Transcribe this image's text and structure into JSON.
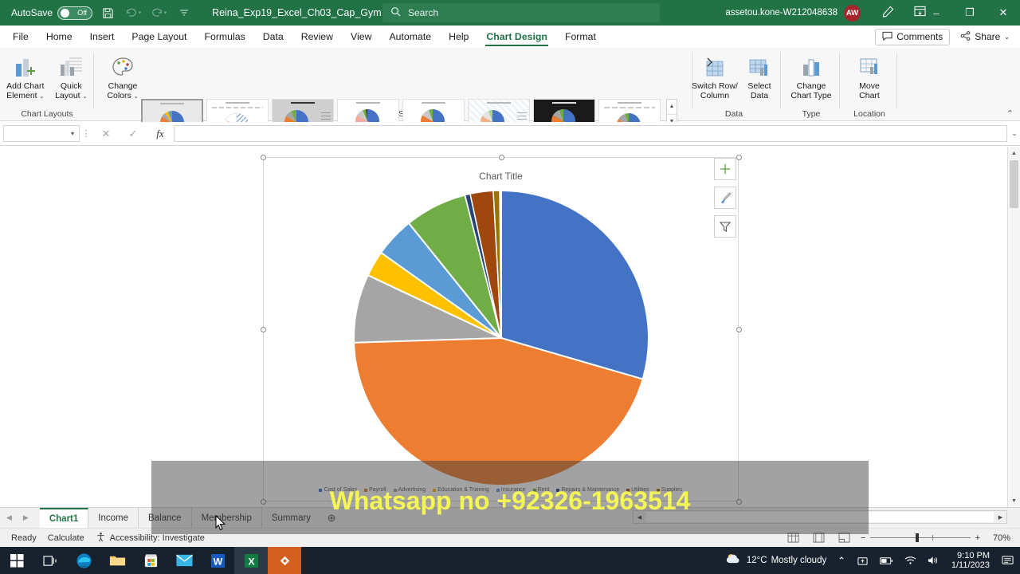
{
  "titlebar": {
    "autosave_label": "AutoSave",
    "autosave_state": "Off",
    "save_icon": "save-icon",
    "undo_icon": "undo-icon",
    "redo_icon": "redo-icon",
    "customize_icon": "customize-quick-access-icon",
    "document_title": "Reina_Exp19_Excel_Ch03_Cap_Gym",
    "title_chevron": "chevron-down-icon",
    "search_placeholder": "Search",
    "search_icon": "search-icon",
    "user_name": "assetou.kone-W212048638",
    "avatar_initials": "AW",
    "pen_icon": "pen-icon",
    "ribbon_display_icon": "ribbon-display-options-icon",
    "minimize": "–",
    "restore": "❐",
    "close": "✕"
  },
  "menubar": {
    "items": [
      {
        "label": "File",
        "active": false
      },
      {
        "label": "Home",
        "active": false
      },
      {
        "label": "Insert",
        "active": false
      },
      {
        "label": "Page Layout",
        "active": false
      },
      {
        "label": "Formulas",
        "active": false
      },
      {
        "label": "Data",
        "active": false
      },
      {
        "label": "Review",
        "active": false
      },
      {
        "label": "View",
        "active": false
      },
      {
        "label": "Automate",
        "active": false
      },
      {
        "label": "Help",
        "active": false
      },
      {
        "label": "Chart Design",
        "active": true
      },
      {
        "label": "Format",
        "active": false
      }
    ],
    "comments_label": "Comments",
    "share_label": "Share"
  },
  "ribbon": {
    "groups": [
      {
        "name": "Chart Layouts",
        "label": "Chart Layouts"
      },
      {
        "name": "Chart Styles",
        "label": "Chart Styles"
      },
      {
        "name": "Data",
        "label": "Data"
      },
      {
        "name": "Type",
        "label": "Type"
      },
      {
        "name": "Location",
        "label": "Location"
      }
    ],
    "buttons": {
      "add_chart_element": "Add Chart\nElement",
      "add_chart_element_l1": "Add Chart",
      "add_chart_element_l2": "Element",
      "quick_layout_l1": "Quick",
      "quick_layout_l2": "Layout",
      "change_colors_l1": "Change",
      "change_colors_l2": "Colors",
      "switch_row_column_l1": "Switch Row/",
      "switch_row_column_l2": "Column",
      "select_data_l1": "Select",
      "select_data_l2": "Data",
      "change_chart_type_l1": "Change",
      "change_chart_type_l2": "Chart Type",
      "move_chart_l1": "Move",
      "move_chart_l2": "Chart"
    },
    "gallery_scroll": {
      "up": "▲",
      "down": "▼",
      "more": "☰"
    },
    "collapse_icon": "collapse-ribbon-icon"
  },
  "formulabar": {
    "namebox_value": "",
    "cancel_icon": "cancel-icon",
    "enter_icon": "enter-icon",
    "function_icon": "insert-function-icon",
    "formula_value": "",
    "expand_icon": "expand-formula-bar-icon"
  },
  "chart_data": {
    "type": "pie",
    "title": "Chart Title",
    "legend_position": "bottom",
    "categories": [
      "Cost of Sales",
      "Payroll",
      "Advertising",
      "Education & Training",
      "Insurance",
      "Rent",
      "Repairs & Maintenance",
      "Utilities",
      "Supplies"
    ],
    "values": [
      20.5,
      55.0,
      5.5,
      2.8,
      2.0,
      5.0,
      1.0,
      0.2,
      8.0
    ],
    "colors": [
      "#4472c4",
      "#ed7d31",
      "#a5a5a5",
      "#ffc000",
      "#5b9bd5",
      "#70ad47",
      "#264478",
      "#9e480e",
      "#997300"
    ],
    "xlabel": "",
    "ylabel": "",
    "grid": false,
    "start_angle_deg": 0
  },
  "chart_buttons": {
    "elements": "chart-elements-icon",
    "styles": "chart-styles-icon",
    "filters": "chart-filters-icon"
  },
  "sheet_tabs": {
    "nav_prev": "◀",
    "nav_next": "▶",
    "tabs": [
      {
        "label": "Chart1",
        "active": true
      },
      {
        "label": "Income",
        "active": false
      },
      {
        "label": "Balance",
        "active": false
      },
      {
        "label": "Membership",
        "active": false
      },
      {
        "label": "Summary",
        "active": false
      }
    ],
    "add_sheet": "⊕"
  },
  "statusbar": {
    "mode": "Ready",
    "calc": "Calculate",
    "accessibility_icon": "accessibility-icon",
    "accessibility": "Accessibility: Investigate",
    "view_normal": "normal-view-icon",
    "view_pagelayout": "page-layout-view-icon",
    "view_pagebreak": "page-break-preview-icon",
    "zoom_out": "−",
    "zoom_in": "+",
    "zoom_level": "70%"
  },
  "taskbar": {
    "apps": [
      {
        "name": "start-icon"
      },
      {
        "name": "task-view-icon"
      },
      {
        "name": "edge-icon"
      },
      {
        "name": "file-explorer-icon"
      },
      {
        "name": "microsoft-store-icon"
      },
      {
        "name": "mail-icon"
      },
      {
        "name": "word-icon"
      },
      {
        "name": "excel-icon"
      },
      {
        "name": "screen-recorder-icon"
      }
    ],
    "weather_temp": "12°C",
    "weather_desc": "Mostly cloudy",
    "chevron_up": "⌃",
    "onedrive_icon": "onedrive-icon",
    "battery_icon": "battery-icon",
    "wifi_icon": "wifi-icon",
    "volume_icon": "volume-icon",
    "time": "9:10 PM",
    "date": "1/11/2023",
    "notification_icon": "notifications-icon"
  },
  "overlay": {
    "watermark": "Whatsapp no +92326-1963514"
  }
}
